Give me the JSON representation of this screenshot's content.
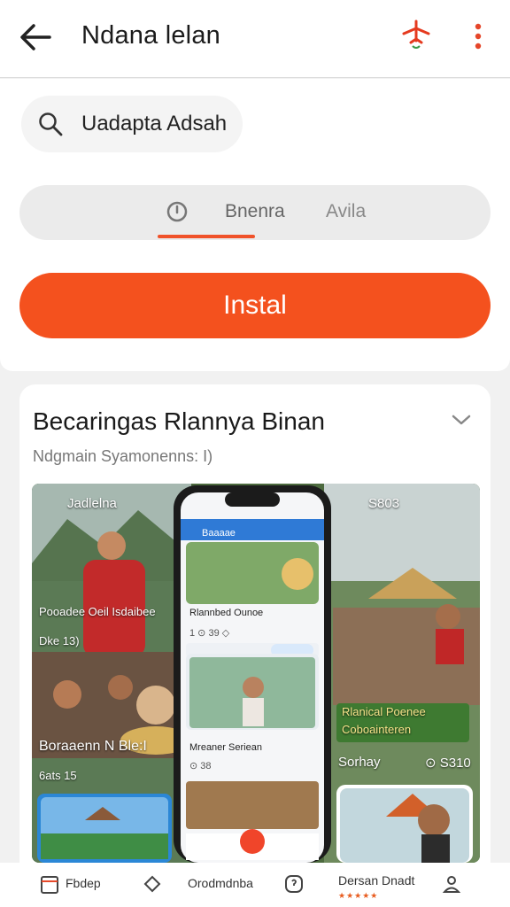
{
  "header": {
    "title": "Ndana lelan",
    "back_icon": "arrow-left-icon",
    "action_icon": "plane-icon",
    "more_icon": "more-vertical-icon"
  },
  "search": {
    "value": "Uadapta Adsah",
    "icon": "search-icon"
  },
  "tabs": [
    {
      "label": "Bnenra",
      "active": true
    },
    {
      "label": "Avila",
      "active": false
    }
  ],
  "install_label": "Instal",
  "card": {
    "title": "Becaringas Rlannya Binan",
    "subtitle": "Ndgmain Syamonenns: I)",
    "gallery": {
      "left_profile": "Jadlelna",
      "left_caption_1": "Pooadee Oeil Isdaibee",
      "left_caption_2": "Dke 13)",
      "left_caption_3": "Boraaenn N Ble:I",
      "left_caption_4": "6ats 15",
      "phone_header": "Baaaae",
      "phone_item_1": "Rlannbed Ounoe",
      "phone_item_1_meta": "1 ⊙ 39 ◇",
      "phone_item_2": "Mreaner Seriean",
      "phone_item_2_meta": "⊙ 38",
      "right_status": "S803",
      "right_caption_1": "Rlanical Poenee",
      "right_caption_2": "Coboainteren",
      "right_caption_3": "Sorhay",
      "right_caption_4": "⊙ S310"
    }
  },
  "bottom_nav": [
    {
      "label": "Fbdep",
      "icon": "calendar-icon"
    },
    {
      "label": "Orodmdnba",
      "icon": "tag-icon"
    },
    {
      "label": "",
      "icon": "circle-question-icon"
    },
    {
      "label": "Dersan Dnadt",
      "icon": "",
      "stars": "★★★★★"
    },
    {
      "label": "",
      "icon": "person-icon"
    }
  ],
  "colors": {
    "accent": "#f4511e",
    "tab_underline": "#f0522a"
  }
}
